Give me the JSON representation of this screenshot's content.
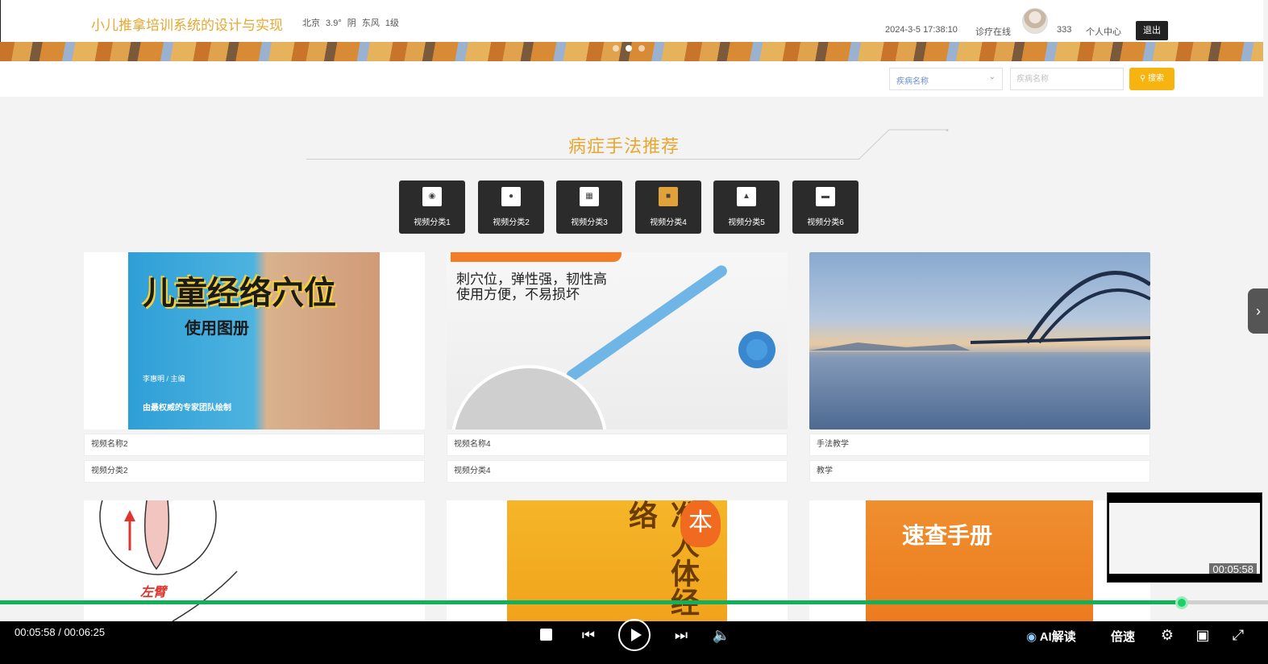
{
  "header": {
    "site_title": "小儿推拿培训系统的设计与实现",
    "weather": "北京 3.9° 阴 东风 1级",
    "datetime": "2024-3-5 17:38:10",
    "clinic_online": "诊疗在线",
    "username": "333",
    "profile": "个人中心",
    "logout": "退出"
  },
  "search": {
    "select_value": "疾病名称",
    "input_placeholder": "疾病名称",
    "button_label": "搜索"
  },
  "section": {
    "title": "病症手法推荐"
  },
  "categories": [
    {
      "label": "视频分类1"
    },
    {
      "label": "视频分类2"
    },
    {
      "label": "视频分类3"
    },
    {
      "label": "视频分类4"
    },
    {
      "label": "视频分类5"
    },
    {
      "label": "视频分类6"
    }
  ],
  "cards": [
    {
      "name": "视频名称2",
      "category": "视频分类2"
    },
    {
      "name": "视频名称4",
      "category": "视频分类4"
    },
    {
      "name": "手法教学",
      "category": "教学"
    }
  ],
  "thumb_text": {
    "book1_title": "儿童经络穴位",
    "book1_sub": "使用图册",
    "book1_editor": "李惠明 / 主编",
    "book1_footer": "由最权威的专家团队绘制",
    "massager_text_1": "刺穴位，弹性强，韧性高",
    "massager_text_2": "使用方便，不易损坏",
    "left_label": "左臂",
    "book2_title": "准人体经络",
    "book2_mark": "本",
    "book3_title": "速查手册"
  },
  "mini_player": {
    "time": "00:05:58"
  },
  "player": {
    "current_time": "00:05:58",
    "total_time": "00:06:25",
    "time_display": "00:05:58 / 00:06:25",
    "progress": 0.932,
    "ai_label": "AI解读",
    "speed_label": "倍速",
    "accent_color": "#11b15a"
  },
  "colors": {
    "title": "#e6a832",
    "search_button": "#f7b30f",
    "category_bg": "#2b2b2b"
  }
}
